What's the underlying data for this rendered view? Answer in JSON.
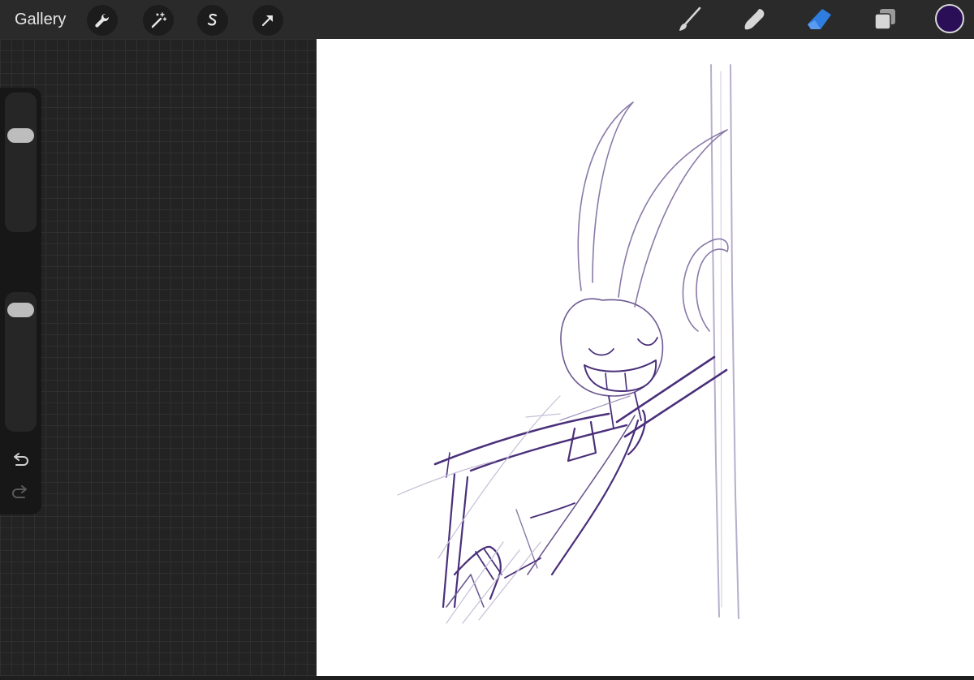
{
  "toolbar": {
    "gallery_label": "Gallery",
    "left_tools": [
      "wrench-icon",
      "magic-wand-icon",
      "selection-icon",
      "transform-arrow-icon"
    ],
    "right_tools": [
      "brush-icon",
      "smudge-icon",
      "eraser-icon",
      "layers-icon"
    ],
    "active_tool": "eraser",
    "active_tool_color": "#2f7de1",
    "current_color": "#2a0f57"
  },
  "sidebar": {
    "brush_size_level": 0.72,
    "opacity_level": 0.93,
    "modify_button_icon": "square-icon",
    "undo_icon": "undo-icon",
    "redo_icon": "redo-icon",
    "redo_enabled": false
  },
  "canvas": {
    "background": "#ffffff",
    "sketch_color": "#4a2f7a",
    "sketch_light_color": "#a79bc0"
  }
}
